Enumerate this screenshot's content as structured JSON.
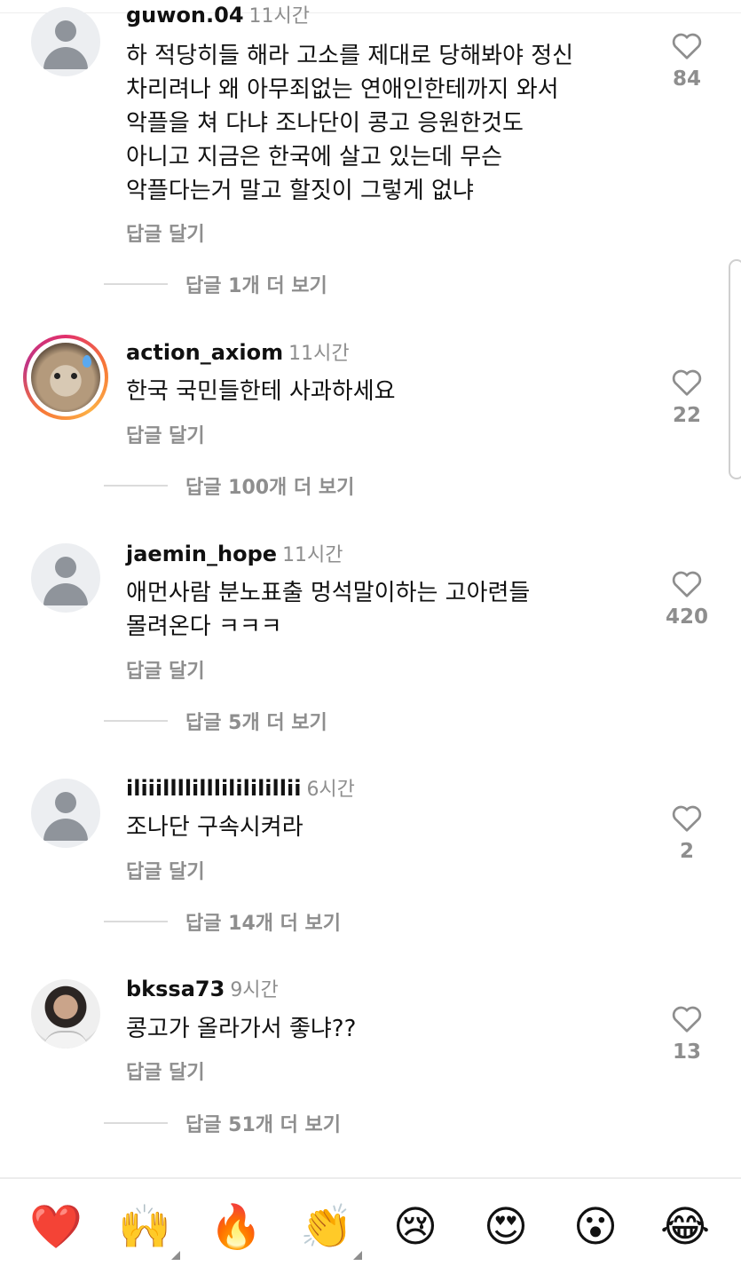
{
  "comments": [
    {
      "username": "guwon.04",
      "time": "11시간",
      "text": "하 적당히들 해라 고소를 제대로 당해봐야 정신\n차리려나 왜 아무죄없는 연애인한테까지 와서\n악플을 쳐 다냐 조나단이 콩고 응원한것도\n아니고 지금은 한국에 살고 있는데 무슨\n악플다는거 말고 할짓이 그렇게 없냐",
      "reply_label": "답글 달기",
      "likes": "84",
      "more_replies": "답글 1개 더 보기",
      "avatar": "default-avatar"
    },
    {
      "username": "action_axiom",
      "time": "11시간",
      "text": "한국 국민들한테 사과하세요",
      "reply_label": "답글 달기",
      "likes": "22",
      "more_replies": "답글 100개 더 보기",
      "avatar": "hamster-story-avatar"
    },
    {
      "username": "jaemin_hope",
      "time": "11시간",
      "text": "애먼사람 분노표출 멍석말이하는 고아련들\n몰려온다 ㅋㅋㅋ",
      "reply_label": "답글 달기",
      "likes": "420",
      "more_replies": "답글 5개 더 보기",
      "avatar": "default-avatar"
    },
    {
      "username": "iliiillllilllilililillii",
      "time": "6시간",
      "text": "조나단 구속시켜라",
      "reply_label": "답글 달기",
      "likes": "2",
      "more_replies": "답글 14개 더 보기",
      "avatar": "default-avatar"
    },
    {
      "username": "bkssa73",
      "time": "9시간",
      "text": "콩고가 올라가서 좋냐??",
      "reply_label": "답글 달기",
      "likes": "13",
      "more_replies": "답글 51개 더 보기",
      "avatar": "photo-avatar"
    }
  ],
  "emoji_bar": [
    "❤️",
    "🙌",
    "🔥",
    "👏",
    "😢",
    "😍",
    "😮",
    "😂"
  ]
}
